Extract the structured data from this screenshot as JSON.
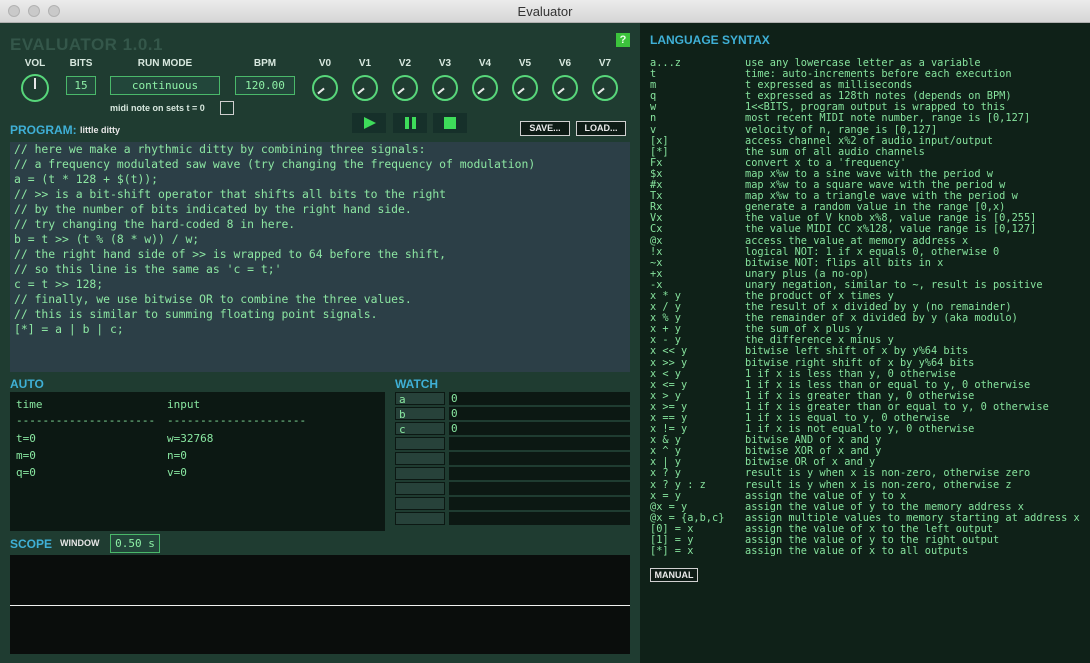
{
  "window": {
    "title": "Evaluator"
  },
  "app": {
    "title": "EVALUATOR 1.0.1",
    "help": "?"
  },
  "controls": {
    "vol_label": "VOL",
    "bits_label": "BITS",
    "bits_value": "15",
    "run_mode_label": "RUN MODE",
    "run_mode_value": "continuous",
    "bpm_label": "BPM",
    "bpm_value": "120.00",
    "midi_note_label": "midi note on sets t = 0",
    "knobs": [
      "V0",
      "V1",
      "V2",
      "V3",
      "V4",
      "V5",
      "V6",
      "V7"
    ]
  },
  "program": {
    "label": "PROGRAM:",
    "name": "little ditty",
    "save_label": "SAVE...",
    "load_label": "LOAD...",
    "lines": [
      "// here we make a rhythmic ditty by combining three signals:",
      "// a frequency modulated saw wave (try changing the frequency of modulation)",
      "a = (t * 128 + $(t));",
      "// >> is a bit-shift operator that shifts all bits to the right",
      "// by the number of bits indicated by the right hand side.",
      "// try changing the hard-coded 8 in here.",
      "b = t >> (t % (8 * w)) / w;",
      "// the right hand side of >> is wrapped to 64 before the shift,",
      "// so this line is the same as 'c = t;'",
      "c = t >> 128;",
      "// finally, we use bitwise OR to combine the three values.",
      "// this is similar to summing floating point signals.",
      "[*] = a | b | c;"
    ]
  },
  "auto": {
    "label": "AUTO",
    "col1": "time",
    "col2": "input",
    "sep": "---------------------",
    "rows": [
      [
        "t=0",
        "w=32768"
      ],
      [
        "m=0",
        "n=0"
      ],
      [
        "q=0",
        "v=0"
      ]
    ]
  },
  "watch": {
    "label": "WATCH",
    "rows": [
      [
        "a",
        "0"
      ],
      [
        "b",
        "0"
      ],
      [
        "c",
        "0"
      ],
      [
        "",
        ""
      ],
      [
        "",
        ""
      ],
      [
        "",
        ""
      ],
      [
        "",
        ""
      ],
      [
        "",
        ""
      ],
      [
        "",
        ""
      ]
    ]
  },
  "scope": {
    "label": "SCOPE",
    "window_label": "WINDOW",
    "window_value": "0.50 s"
  },
  "syntax": {
    "title": "LANGUAGE SYNTAX",
    "manual_label": "MANUAL",
    "items": [
      [
        "a...z",
        "use any lowercase letter as a variable"
      ],
      [
        "t",
        "time: auto-increments before each execution"
      ],
      [
        "m",
        "t expressed as milliseconds"
      ],
      [
        "q",
        "t expressed as 128th notes (depends on BPM)"
      ],
      [
        "w",
        "1<<BITS, program output is wrapped to this"
      ],
      [
        "n",
        "most recent MIDI note number, range is [0,127]"
      ],
      [
        "v",
        "velocity of n, range is [0,127]"
      ],
      [
        "[x]",
        "access channel x%2 of audio input/output"
      ],
      [
        "[*]",
        "the sum of all audio channels"
      ],
      [
        "Fx",
        "convert x to a 'frequency'"
      ],
      [
        "$x",
        "map x%w to a sine wave with the period w"
      ],
      [
        "#x",
        "map x%w to a square wave with the period w"
      ],
      [
        "Tx",
        "map x%w to a triangle wave with the period w"
      ],
      [
        "Rx",
        "generate a random value in the range [0,x)"
      ],
      [
        "Vx",
        "the value of V knob x%8, value range is [0,255]"
      ],
      [
        "Cx",
        "the value MIDI CC x%128, value range is [0,127]"
      ],
      [
        "@x",
        "access the value at memory address x"
      ],
      [
        "!x",
        "logical NOT: 1 if x equals 0, otherwise 0"
      ],
      [
        "~x",
        "bitwise NOT: flips all bits in x"
      ],
      [
        "+x",
        "unary plus (a no-op)"
      ],
      [
        "-x",
        "unary negation, similar to ~, result is positive"
      ],
      [
        "x * y",
        "the product of x times y"
      ],
      [
        "x / y",
        "the result of x divided by y (no remainder)"
      ],
      [
        "x % y",
        "the remainder of x divided by y (aka modulo)"
      ],
      [
        "x + y",
        "the sum of x plus y"
      ],
      [
        "x - y",
        "the difference x minus y"
      ],
      [
        "x << y",
        "bitwise left shift of x by y%64 bits"
      ],
      [
        "x >> y",
        "bitwise right shift of x by y%64 bits"
      ],
      [
        "x < y",
        "1 if x is less than y, 0 otherwise"
      ],
      [
        "x <= y",
        "1 if x is less than or equal to y, 0 otherwise"
      ],
      [
        "x > y",
        "1 if x is greater than y, 0 otherwise"
      ],
      [
        "x >= y",
        "1 if x is greater than or equal to y, 0 otherwise"
      ],
      [
        "x == y",
        "1 if x is equal to y, 0 otherwise"
      ],
      [
        "x != y",
        "1 if x is not equal to y, 0 otherwise"
      ],
      [
        "x & y",
        "bitwise AND of x and y"
      ],
      [
        "x ^ y",
        "bitwise XOR of x and y"
      ],
      [
        "x | y",
        "bitwise OR of x and y"
      ],
      [
        "x ? y",
        "result is y when x is non-zero, otherwise zero"
      ],
      [
        "x ? y : z",
        "result is y when x is non-zero, otherwise z"
      ],
      [
        "x = y",
        "assign the value of y to x"
      ],
      [
        "@x = y",
        "assign the value of y to the memory address x"
      ],
      [
        "@x = {a,b,c}",
        "assign multiple values to memory starting at address x"
      ],
      [
        "[0] = x",
        "assign the value of x to the left output"
      ],
      [
        "[1] = y",
        "assign the value of y to the right output"
      ],
      [
        "[*] = x",
        "assign the value of x to all outputs"
      ]
    ]
  }
}
